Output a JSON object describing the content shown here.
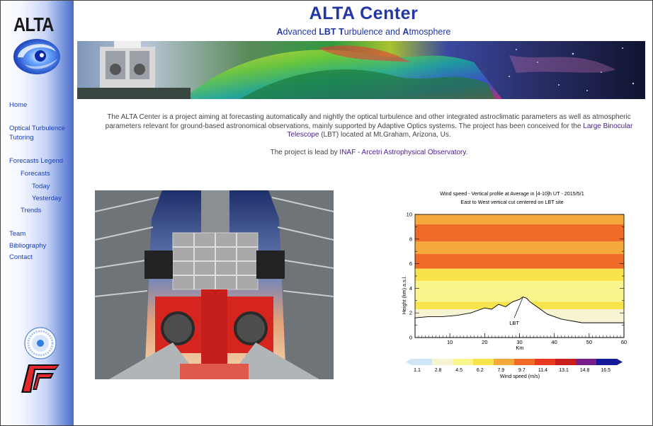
{
  "sidebar": {
    "logo_text": "ALTA",
    "nav": [
      {
        "label": "Home",
        "level": 1
      },
      {
        "label": "Optical Turbulence",
        "level": 1
      },
      {
        "label": "Tutoring",
        "level": 1
      },
      {
        "label": "Forecasts Legend",
        "level": 1
      },
      {
        "label": "Forecasts",
        "level": 2
      },
      {
        "label": "Today",
        "level": 3
      },
      {
        "label": "Yesterday",
        "level": 3
      },
      {
        "label": "Trends",
        "level": 2
      },
      {
        "label": "Team",
        "level": 1
      },
      {
        "label": "Bibliography",
        "level": 1
      },
      {
        "label": "Contact",
        "level": 1
      }
    ]
  },
  "header": {
    "title": "ALTA  Center",
    "subtitle_parts": [
      {
        "b": "A",
        "t": "dvanced "
      },
      {
        "b": "LBT",
        "t": " "
      },
      {
        "b": "T",
        "t": "urbulence and "
      },
      {
        "b": "A",
        "t": "tmosphere"
      }
    ]
  },
  "intro": {
    "text1": "The ALTA Center is a project aiming at forecasting automatically and nightly the optical turbulence and other integrated astroclimatic parameters as well as atmospheric parameters relevant for ground-based astronomical observations, mainly supported by Adaptive Optics systems. The project has been conceived for the ",
    "link1": "Large Binocular Telescope",
    "text2": " (LBT) located at Mt.Graham, Arizona, Us.",
    "lead_text": "The project is lead by ",
    "lead_link": "INAF - Arcetri Astrophysical Observatory",
    "lead_end": "."
  },
  "chart_data": {
    "type": "heatmap",
    "title": "Wind speed - Vertical profile at Average in [4-10]h UT - 2015/5/1",
    "subtitle": "East to West vertical cut centered on LBT site",
    "xlabel": "Km",
    "ylabel": "Height (km) a.s.l.",
    "xlim": [
      0,
      60
    ],
    "ylim": [
      0,
      10
    ],
    "xticks": [
      10,
      20,
      30,
      40,
      50,
      60
    ],
    "yticks": [
      0,
      2,
      4,
      6,
      8,
      10
    ],
    "annotation": "LBT",
    "colorbar_label": "Wind speed (m/s)",
    "colorbar_ticks": [
      "1.1",
      "2.8",
      "4.5",
      "6.2",
      "7.9",
      "9.7",
      "11.4",
      "13.1",
      "14.8",
      "16.5"
    ],
    "colorbar_colors": [
      "#cde6f8",
      "#f7f4d3",
      "#fbf58e",
      "#f7e44d",
      "#f5a93a",
      "#f06a28",
      "#e93a20",
      "#c81e1e",
      "#7a1e8c",
      "#151a9a"
    ],
    "bands": [
      {
        "y0": 0,
        "y1": 2.3,
        "speed": 4.3
      },
      {
        "y0": 2.3,
        "y1": 2.9,
        "speed": 6.4
      },
      {
        "y0": 2.9,
        "y1": 3.9,
        "speed": 4.6
      },
      {
        "y0": 3.9,
        "y1": 4.6,
        "speed": 5.6
      },
      {
        "y0": 4.6,
        "y1": 5.6,
        "speed": 7.6
      },
      {
        "y0": 5.6,
        "y1": 6.8,
        "speed": 10.2
      },
      {
        "y0": 6.8,
        "y1": 7.8,
        "speed": 8.6
      },
      {
        "y0": 7.8,
        "y1": 9.2,
        "speed": 9.9
      },
      {
        "y0": 9.2,
        "y1": 10,
        "speed": 8.8
      }
    ],
    "terrain": {
      "x": [
        0,
        4,
        8,
        12,
        16,
        20,
        22,
        24,
        26,
        28,
        29,
        30,
        31,
        32,
        33,
        34,
        36,
        38,
        40,
        42,
        44,
        46,
        48,
        52,
        56,
        60
      ],
      "y": [
        1.6,
        1.7,
        1.7,
        1.8,
        2.0,
        2.4,
        2.3,
        2.7,
        2.5,
        2.9,
        3.0,
        3.1,
        3.3,
        3.2,
        2.9,
        2.7,
        2.3,
        1.9,
        1.7,
        1.5,
        1.4,
        1.3,
        1.2,
        1.2,
        1.2,
        1.2
      ]
    }
  }
}
